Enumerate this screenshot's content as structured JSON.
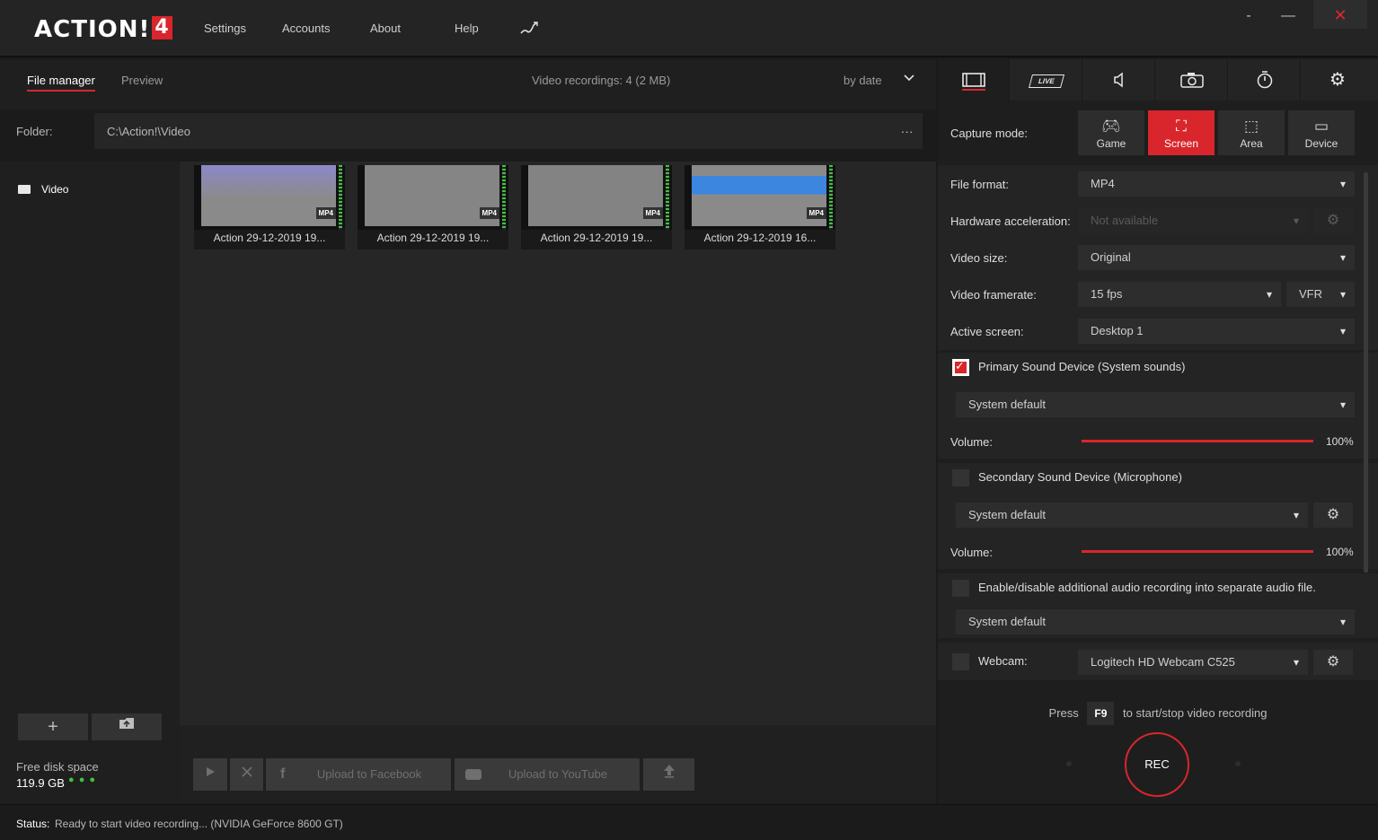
{
  "app": {
    "logo_text": "ACTION!",
    "logo_version": "4"
  },
  "menu": {
    "settings": "Settings",
    "accounts": "Accounts",
    "about": "About",
    "help": "Help"
  },
  "window": {
    "minimize": "-",
    "maximize": "—",
    "close": "✕"
  },
  "tabs": {
    "file_manager": "File manager",
    "preview": "Preview"
  },
  "recordings_count": "Video recordings: 4 (2 MB)",
  "sort": "by date",
  "folder": {
    "label": "Folder:",
    "path": "C:\\Action!\\Video",
    "browse": "..."
  },
  "sidebar": {
    "video_label": "Video",
    "add": "+",
    "disk_label": "Free disk space",
    "disk_value": "119.9 GB"
  },
  "thumbnails": [
    {
      "name": "Action 29-12-2019 19...",
      "badge": "MP4"
    },
    {
      "name": "Action 29-12-2019 19...",
      "badge": "MP4"
    },
    {
      "name": "Action 29-12-2019 19...",
      "badge": "MP4"
    },
    {
      "name": "Action 29-12-2019 16...",
      "badge": "MP4"
    }
  ],
  "actions": {
    "upload_facebook": "Upload to Facebook",
    "upload_youtube": "Upload to YouTube"
  },
  "status": {
    "label": "Status:",
    "text": "Ready to start video recording... (NVIDIA GeForce 8600 GT)"
  },
  "right": {
    "live_tab": "LIVE",
    "capture_mode_label": "Capture mode:",
    "capture_modes": [
      "Game",
      "Screen",
      "Area",
      "Device"
    ],
    "capture_mode_selected": "Screen",
    "file_format_label": "File format:",
    "file_format": "MP4",
    "hw_accel_label": "Hardware acceleration:",
    "hw_accel": "Not available",
    "video_size_label": "Video size:",
    "video_size": "Original",
    "framerate_label": "Video framerate:",
    "framerate": "15 fps",
    "framerate_mode": "VFR",
    "active_screen_label": "Active screen:",
    "active_screen": "Desktop 1",
    "primary_sound_label": "Primary Sound Device (System sounds)",
    "primary_sound_checked": true,
    "primary_sound_device": "System default",
    "volume_label": "Volume:",
    "primary_volume": "100%",
    "primary_volume_level": 1.0,
    "secondary_sound_label": "Secondary Sound Device (Microphone)",
    "secondary_sound_checked": false,
    "secondary_sound_device": "System default",
    "secondary_volume": "100%",
    "secondary_volume_level": 1.0,
    "additional_audio_label": "Enable/disable additional audio recording into separate audio file.",
    "additional_audio_device": "System default",
    "webcam_label": "Webcam:",
    "webcam_device": "Logitech HD Webcam C525",
    "press_label": "Press",
    "hotkey": "F9",
    "press_suffix": "to start/stop video recording",
    "rec_label": "REC"
  },
  "colors": {
    "accent": "#d8262c",
    "ok": "#3ec43e"
  }
}
